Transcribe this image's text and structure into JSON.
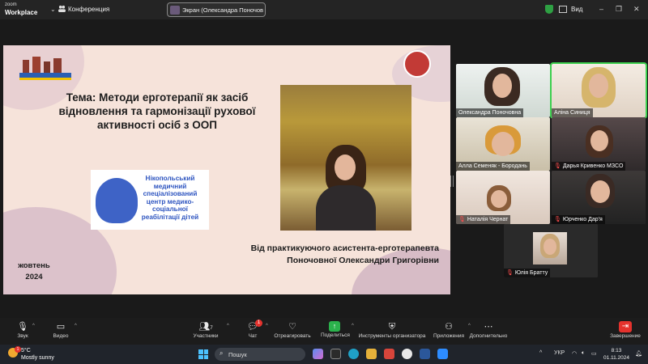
{
  "app": {
    "brand_small": "zoom",
    "brand_big": "Workplace",
    "conference_label": "Конференция"
  },
  "share_pill": {
    "label": "Экран (Олександра Поночовна)"
  },
  "top_right": {
    "view_label": "Вид",
    "minimize": "–",
    "restore": "❐",
    "close": "✕"
  },
  "slide": {
    "title": "Тема: Методи ерготерапії як засіб відновлення та гармонізації рухової активності осіб з ООП",
    "logo_text": "Нікопольський медичний спеціалізований центр медико-соціальної реабілітації дітей",
    "author_line1": "Від практикуючого асистента-ерготерапевта",
    "author_line2": "Поночовної Олександри Григорівни",
    "date_line1": "жовтень",
    "date_line2": "2024"
  },
  "participants": [
    {
      "name": "Олександра Поночовна",
      "muted": false
    },
    {
      "name": "Аліна Синиця",
      "muted": false
    },
    {
      "name": "Алла Семеняк - Бородань",
      "muted": false
    },
    {
      "name": "Дарья Кривенко МЗСО",
      "muted": true
    },
    {
      "name": "Наталія Чернат",
      "muted": true
    },
    {
      "name": "Юрченко Дар'я",
      "muted": true
    },
    {
      "name": "Юлія Братту",
      "muted": true
    }
  ],
  "toolbar": {
    "audio": "Звук",
    "video": "Видео",
    "participants": "Участники",
    "participants_count": "7",
    "chat": "Чат",
    "chat_badge": "1",
    "react": "Отреагировать",
    "share": "Поделиться",
    "host_tools": "Инструменты организатора",
    "apps": "Приложения",
    "more": "Дополнительно",
    "end": "Завершение"
  },
  "taskbar": {
    "weather_temp": "5°C",
    "weather_desc": "Mostly sunny",
    "weather_badge": "1",
    "search_placeholder": "Пошук",
    "lang": "УКР",
    "time": "8:13",
    "date": "01.11.2024"
  },
  "icons": {
    "conference": "people-icon",
    "shield": "shield-icon",
    "mic": "mic-icon",
    "video": "video-camera-icon",
    "participants": "people-icon",
    "chat": "chat-bubble-icon",
    "react": "heart-icon",
    "share": "share-up-arrow-icon",
    "host_tools": "shield-icon",
    "apps": "apps-icon",
    "more": "ellipsis-icon",
    "end": "exit-icon"
  },
  "colors": {
    "accent_green": "#2bb24c",
    "end_red": "#e5322d",
    "active_speaker": "#3ccf4e",
    "slide_bg": "#f6e3da"
  }
}
